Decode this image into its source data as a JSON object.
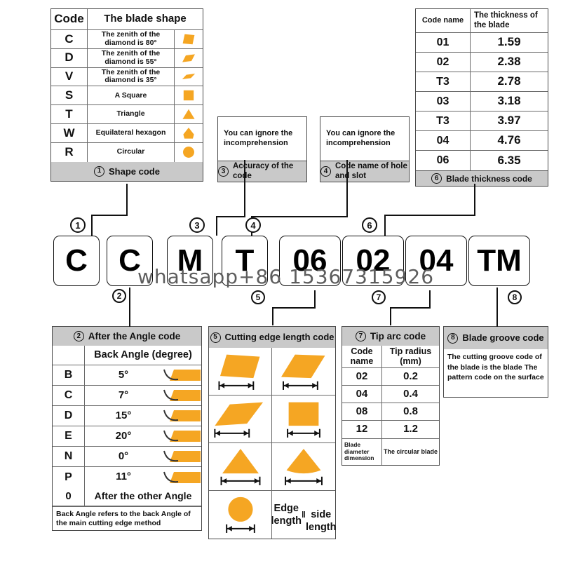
{
  "orange": "#F5A623",
  "header_gray": "#C9C9C9",
  "watermark": "whatsapp+86  15367315926",
  "shape_table": {
    "marker": "1",
    "footer_label": "Shape code",
    "col_code": "Code",
    "col_shape": "The blade shape",
    "rows": [
      {
        "code": "C",
        "desc": "The zenith of the diamond is 80°",
        "icon": "parallelogram-80-icon"
      },
      {
        "code": "D",
        "desc": "The zenith of the diamond is 55°",
        "icon": "parallelogram-55-icon"
      },
      {
        "code": "V",
        "desc": "The zenith of the diamond is 35°",
        "icon": "parallelogram-35-icon"
      },
      {
        "code": "S",
        "desc": "A Square",
        "icon": "square-icon"
      },
      {
        "code": "T",
        "desc": "Triangle",
        "icon": "triangle-icon"
      },
      {
        "code": "W",
        "desc": "Equilateral hexagon",
        "icon": "hexagon-icon"
      },
      {
        "code": "R",
        "desc": "Circular",
        "icon": "circle-icon"
      }
    ]
  },
  "thickness_table": {
    "marker": "6",
    "footer_label": "Blade thickness code",
    "col_code": "Code name",
    "col_thick": "The thickness of the blade",
    "rows": [
      {
        "code": "01",
        "value": "1.59"
      },
      {
        "code": "02",
        "value": "2.38"
      },
      {
        "code": "T3",
        "value": "2.78"
      },
      {
        "code": "03",
        "value": "3.18"
      },
      {
        "code": "T3",
        "value": "3.97"
      },
      {
        "code": "04",
        "value": "4.76"
      },
      {
        "code": "06",
        "value": "6.35"
      }
    ]
  },
  "note3": {
    "marker": "3",
    "body": "You can ignore the incomprehension",
    "footer_label": "Accuracy of the code"
  },
  "note4": {
    "marker": "4",
    "body": "You can ignore the incomprehension",
    "footer_label": "Code name of hole and slot"
  },
  "angle_table": {
    "marker": "2",
    "title": "After the Angle code",
    "subheader": "Back Angle (degree)",
    "rows": [
      {
        "code": "B",
        "value": "5°"
      },
      {
        "code": "C",
        "value": "7°"
      },
      {
        "code": "D",
        "value": "15°"
      },
      {
        "code": "E",
        "value": "20°"
      },
      {
        "code": "N",
        "value": "0°"
      },
      {
        "code": "P",
        "value": "11°"
      }
    ],
    "other_code": "0",
    "other_label": "After the other Angle",
    "note": "Back Angle refers to the back Angle of the main cutting edge method"
  },
  "edge_table": {
    "marker": "5",
    "title": "Cutting edge length code",
    "cells": [
      "parallelogram-80-icon",
      "parallelogram-55-icon",
      "parallelogram-35-icon",
      "square-icon",
      "triangle-icon",
      "hexagon-icon",
      "circle-icon"
    ],
    "last_label": "Edge length ‖ side length"
  },
  "tip_table": {
    "marker": "7",
    "title": "Tip arc code",
    "col_code": "Code name",
    "col_radius": "Tip radius (mm)",
    "rows": [
      {
        "code": "02",
        "value": "0.2"
      },
      {
        "code": "04",
        "value": "0.4"
      },
      {
        "code": "08",
        "value": "0.8"
      },
      {
        "code": "12",
        "value": "1.2"
      }
    ],
    "foot_left": "Blade diameter dimension",
    "foot_right": "The circular blade"
  },
  "groove_table": {
    "marker": "8",
    "title": "Blade groove code",
    "body": "The cutting groove code of the blade is the blade The pattern code on  the surface"
  },
  "code_string": {
    "boxes": [
      {
        "text": "C",
        "marker": "1",
        "width": "w1"
      },
      {
        "text": "C",
        "marker": "2",
        "width": "w1"
      },
      {
        "text": "M",
        "marker": "3",
        "width": "w1"
      },
      {
        "text": "T",
        "marker": "4",
        "width": "w1"
      },
      {
        "text": "06",
        "marker": "5",
        "width": "w2"
      },
      {
        "text": "02",
        "marker": "6",
        "width": "w2"
      },
      {
        "text": "04",
        "marker": "7",
        "width": "w2"
      },
      {
        "text": "TM",
        "marker": "8",
        "width": "w2"
      }
    ]
  }
}
